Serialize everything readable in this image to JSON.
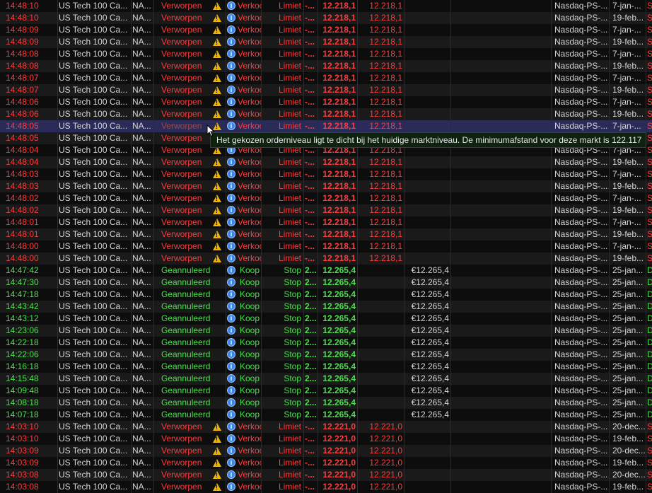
{
  "rows": [
    {
      "time": "14:48:10",
      "instrument": "US Tech 100 Ca...",
      "account": "NA...",
      "status": "Verworpen",
      "warn": true,
      "side": "Verkoop",
      "type": "Limiet",
      "dur": "-...",
      "price": "12.218,1",
      "level": "12.218,1",
      "value": "",
      "market": "Nasdaq-PS-...",
      "date": "7-jan-...",
      "tag": "S",
      "color": "red"
    },
    {
      "time": "14:48:10",
      "instrument": "US Tech 100 Ca...",
      "account": "NA...",
      "status": "Verworpen",
      "warn": true,
      "side": "Verkoop",
      "type": "Limiet",
      "dur": "-...",
      "price": "12.218,1",
      "level": "12.218,1",
      "value": "",
      "market": "Nasdaq-PS-...",
      "date": "19-feb...",
      "tag": "S",
      "color": "red"
    },
    {
      "time": "14:48:09",
      "instrument": "US Tech 100 Ca...",
      "account": "NA...",
      "status": "Verworpen",
      "warn": true,
      "side": "Verkoop",
      "type": "Limiet",
      "dur": "-...",
      "price": "12.218,1",
      "level": "12.218,1",
      "value": "",
      "market": "Nasdaq-PS-...",
      "date": "7-jan-...",
      "tag": "S",
      "color": "red"
    },
    {
      "time": "14:48:09",
      "instrument": "US Tech 100 Ca...",
      "account": "NA...",
      "status": "Verworpen",
      "warn": true,
      "side": "Verkoop",
      "type": "Limiet",
      "dur": "-...",
      "price": "12.218,1",
      "level": "12.218,1",
      "value": "",
      "market": "Nasdaq-PS-...",
      "date": "19-feb...",
      "tag": "S",
      "color": "red"
    },
    {
      "time": "14:48:08",
      "instrument": "US Tech 100 Ca...",
      "account": "NA...",
      "status": "Verworpen",
      "warn": true,
      "side": "Verkoop",
      "type": "Limiet",
      "dur": "-...",
      "price": "12.218,1",
      "level": "12.218,1",
      "value": "",
      "market": "Nasdaq-PS-...",
      "date": "7-jan-...",
      "tag": "S",
      "color": "red"
    },
    {
      "time": "14:48:08",
      "instrument": "US Tech 100 Ca...",
      "account": "NA...",
      "status": "Verworpen",
      "warn": true,
      "side": "Verkoop",
      "type": "Limiet",
      "dur": "-...",
      "price": "12.218,1",
      "level": "12.218,1",
      "value": "",
      "market": "Nasdaq-PS-...",
      "date": "19-feb...",
      "tag": "S",
      "color": "red"
    },
    {
      "time": "14:48:07",
      "instrument": "US Tech 100 Ca...",
      "account": "NA...",
      "status": "Verworpen",
      "warn": true,
      "side": "Verkoop",
      "type": "Limiet",
      "dur": "-...",
      "price": "12.218,1",
      "level": "12.218,1",
      "value": "",
      "market": "Nasdaq-PS-...",
      "date": "7-jan-...",
      "tag": "S",
      "color": "red"
    },
    {
      "time": "14:48:07",
      "instrument": "US Tech 100 Ca...",
      "account": "NA...",
      "status": "Verworpen",
      "warn": true,
      "side": "Verkoop",
      "type": "Limiet",
      "dur": "-...",
      "price": "12.218,1",
      "level": "12.218,1",
      "value": "",
      "market": "Nasdaq-PS-...",
      "date": "19-feb...",
      "tag": "S",
      "color": "red"
    },
    {
      "time": "14:48:06",
      "instrument": "US Tech 100 Ca...",
      "account": "NA...",
      "status": "Verworpen",
      "warn": true,
      "side": "Verkoop",
      "type": "Limiet",
      "dur": "-...",
      "price": "12.218,1",
      "level": "12.218,1",
      "value": "",
      "market": "Nasdaq-PS-...",
      "date": "7-jan-...",
      "tag": "S",
      "color": "red"
    },
    {
      "time": "14:48:06",
      "instrument": "US Tech 100 Ca...",
      "account": "NA...",
      "status": "Verworpen",
      "warn": true,
      "side": "Verkoop",
      "type": "Limiet",
      "dur": "-...",
      "price": "12.218,1",
      "level": "12.218,1",
      "value": "",
      "market": "Nasdaq-PS-...",
      "date": "19-feb...",
      "tag": "S",
      "color": "red"
    },
    {
      "time": "14:48:05",
      "instrument": "US Tech 100 Ca...",
      "account": "NA...",
      "status": "Verworpen",
      "warn": true,
      "side": "Verkoop",
      "type": "Limiet",
      "dur": "-...",
      "price": "12.218,1",
      "level": "12.218,1",
      "value": "",
      "market": "Nasdaq-PS-...",
      "date": "7-jan-...",
      "tag": "S",
      "color": "red",
      "selected": true
    },
    {
      "time": "14:48:05",
      "instrument": "US Tech 100 Ca...",
      "account": "NA...",
      "status": "Verworpen",
      "warn": true,
      "side": "Verkoop",
      "type": "Limiet",
      "dur": "-...",
      "price": "12.218,1",
      "level": "12.218,1",
      "value": "",
      "market": "Nasdaq-PS-...",
      "date": "19-feb...",
      "tag": "S",
      "color": "red"
    },
    {
      "time": "14:48:04",
      "instrument": "US Tech 100 Ca...",
      "account": "NA...",
      "status": "Verworpen",
      "warn": true,
      "side": "Verkoop",
      "type": "Limiet",
      "dur": "-...",
      "price": "12.218,1",
      "level": "12.218,1",
      "value": "",
      "market": "Nasdaq-PS-...",
      "date": "7-jan-...",
      "tag": "S",
      "color": "red"
    },
    {
      "time": "14:48:04",
      "instrument": "US Tech 100 Ca...",
      "account": "NA...",
      "status": "Verworpen",
      "warn": true,
      "side": "Verkoop",
      "type": "Limiet",
      "dur": "-...",
      "price": "12.218,1",
      "level": "12.218,1",
      "value": "",
      "market": "Nasdaq-PS-...",
      "date": "19-feb...",
      "tag": "S",
      "color": "red"
    },
    {
      "time": "14:48:03",
      "instrument": "US Tech 100 Ca...",
      "account": "NA...",
      "status": "Verworpen",
      "warn": true,
      "side": "Verkoop",
      "type": "Limiet",
      "dur": "-...",
      "price": "12.218,1",
      "level": "12.218,1",
      "value": "",
      "market": "Nasdaq-PS-...",
      "date": "7-jan-...",
      "tag": "S",
      "color": "red"
    },
    {
      "time": "14:48:03",
      "instrument": "US Tech 100 Ca...",
      "account": "NA...",
      "status": "Verworpen",
      "warn": true,
      "side": "Verkoop",
      "type": "Limiet",
      "dur": "-...",
      "price": "12.218,1",
      "level": "12.218,1",
      "value": "",
      "market": "Nasdaq-PS-...",
      "date": "19-feb...",
      "tag": "S",
      "color": "red"
    },
    {
      "time": "14:48:02",
      "instrument": "US Tech 100 Ca...",
      "account": "NA...",
      "status": "Verworpen",
      "warn": true,
      "side": "Verkoop",
      "type": "Limiet",
      "dur": "-...",
      "price": "12.218,1",
      "level": "12.218,1",
      "value": "",
      "market": "Nasdaq-PS-...",
      "date": "7-jan-...",
      "tag": "S",
      "color": "red"
    },
    {
      "time": "14:48:02",
      "instrument": "US Tech 100 Ca...",
      "account": "NA...",
      "status": "Verworpen",
      "warn": true,
      "side": "Verkoop",
      "type": "Limiet",
      "dur": "-...",
      "price": "12.218,1",
      "level": "12.218,1",
      "value": "",
      "market": "Nasdaq-PS-...",
      "date": "19-feb...",
      "tag": "S",
      "color": "red"
    },
    {
      "time": "14:48:01",
      "instrument": "US Tech 100 Ca...",
      "account": "NA...",
      "status": "Verworpen",
      "warn": true,
      "side": "Verkoop",
      "type": "Limiet",
      "dur": "-...",
      "price": "12.218,1",
      "level": "12.218,1",
      "value": "",
      "market": "Nasdaq-PS-...",
      "date": "7-jan-...",
      "tag": "S",
      "color": "red"
    },
    {
      "time": "14:48:01",
      "instrument": "US Tech 100 Ca...",
      "account": "NA...",
      "status": "Verworpen",
      "warn": true,
      "side": "Verkoop",
      "type": "Limiet",
      "dur": "-...",
      "price": "12.218,1",
      "level": "12.218,1",
      "value": "",
      "market": "Nasdaq-PS-...",
      "date": "19-feb...",
      "tag": "S",
      "color": "red"
    },
    {
      "time": "14:48:00",
      "instrument": "US Tech 100 Ca...",
      "account": "NA...",
      "status": "Verworpen",
      "warn": true,
      "side": "Verkoop",
      "type": "Limiet",
      "dur": "-...",
      "price": "12.218,1",
      "level": "12.218,1",
      "value": "",
      "market": "Nasdaq-PS-...",
      "date": "7-jan-...",
      "tag": "S",
      "color": "red"
    },
    {
      "time": "14:48:00",
      "instrument": "US Tech 100 Ca...",
      "account": "NA...",
      "status": "Verworpen",
      "warn": true,
      "side": "Verkoop",
      "type": "Limiet",
      "dur": "-...",
      "price": "12.218,1",
      "level": "12.218,1",
      "value": "",
      "market": "Nasdaq-PS-...",
      "date": "19-feb...",
      "tag": "S",
      "color": "red"
    },
    {
      "time": "14:47:42",
      "instrument": "US Tech 100 Ca...",
      "account": "NA...",
      "status": "Geannuleerd",
      "warn": false,
      "side": "Koop",
      "type": "Stop",
      "dur": "2...",
      "price": "12.265,4",
      "level": "",
      "value": "€12.265,4",
      "market": "Nasdaq-PS-...",
      "date": "25-jan...",
      "tag": "D",
      "color": "green"
    },
    {
      "time": "14:47:30",
      "instrument": "US Tech 100 Ca...",
      "account": "NA...",
      "status": "Geannuleerd",
      "warn": false,
      "side": "Koop",
      "type": "Stop",
      "dur": "2...",
      "price": "12.265,4",
      "level": "",
      "value": "€12.265,4",
      "market": "Nasdaq-PS-...",
      "date": "25-jan...",
      "tag": "D",
      "color": "green"
    },
    {
      "time": "14:47:18",
      "instrument": "US Tech 100 Ca...",
      "account": "NA...",
      "status": "Geannuleerd",
      "warn": false,
      "side": "Koop",
      "type": "Stop",
      "dur": "2...",
      "price": "12.265,4",
      "level": "",
      "value": "€12.265,4",
      "market": "Nasdaq-PS-...",
      "date": "25-jan...",
      "tag": "D",
      "color": "green"
    },
    {
      "time": "14:43:42",
      "instrument": "US Tech 100 Ca...",
      "account": "NA...",
      "status": "Geannuleerd",
      "warn": false,
      "side": "Koop",
      "type": "Stop",
      "dur": "2...",
      "price": "12.265,4",
      "level": "",
      "value": "€12.265,4",
      "market": "Nasdaq-PS-...",
      "date": "25-jan...",
      "tag": "D",
      "color": "green"
    },
    {
      "time": "14:43:12",
      "instrument": "US Tech 100 Ca...",
      "account": "NA...",
      "status": "Geannuleerd",
      "warn": false,
      "side": "Koop",
      "type": "Stop",
      "dur": "2...",
      "price": "12.265,4",
      "level": "",
      "value": "€12.265,4",
      "market": "Nasdaq-PS-...",
      "date": "25-jan...",
      "tag": "D",
      "color": "green"
    },
    {
      "time": "14:23:06",
      "instrument": "US Tech 100 Ca...",
      "account": "NA...",
      "status": "Geannuleerd",
      "warn": false,
      "side": "Koop",
      "type": "Stop",
      "dur": "2...",
      "price": "12.265,4",
      "level": "",
      "value": "€12.265,4",
      "market": "Nasdaq-PS-...",
      "date": "25-jan...",
      "tag": "D",
      "color": "green"
    },
    {
      "time": "14:22:18",
      "instrument": "US Tech 100 Ca...",
      "account": "NA...",
      "status": "Geannuleerd",
      "warn": false,
      "side": "Koop",
      "type": "Stop",
      "dur": "2...",
      "price": "12.265,4",
      "level": "",
      "value": "€12.265,4",
      "market": "Nasdaq-PS-...",
      "date": "25-jan...",
      "tag": "D",
      "color": "green"
    },
    {
      "time": "14:22:06",
      "instrument": "US Tech 100 Ca...",
      "account": "NA...",
      "status": "Geannuleerd",
      "warn": false,
      "side": "Koop",
      "type": "Stop",
      "dur": "2...",
      "price": "12.265,4",
      "level": "",
      "value": "€12.265,4",
      "market": "Nasdaq-PS-...",
      "date": "25-jan...",
      "tag": "D",
      "color": "green"
    },
    {
      "time": "14:16:18",
      "instrument": "US Tech 100 Ca...",
      "account": "NA...",
      "status": "Geannuleerd",
      "warn": false,
      "side": "Koop",
      "type": "Stop",
      "dur": "2...",
      "price": "12.265,4",
      "level": "",
      "value": "€12.265,4",
      "market": "Nasdaq-PS-...",
      "date": "25-jan...",
      "tag": "D",
      "color": "green"
    },
    {
      "time": "14:15:48",
      "instrument": "US Tech 100 Ca...",
      "account": "NA...",
      "status": "Geannuleerd",
      "warn": false,
      "side": "Koop",
      "type": "Stop",
      "dur": "2...",
      "price": "12.265,4",
      "level": "",
      "value": "€12.265,4",
      "market": "Nasdaq-PS-...",
      "date": "25-jan...",
      "tag": "D",
      "color": "green"
    },
    {
      "time": "14:09:48",
      "instrument": "US Tech 100 Ca...",
      "account": "NA...",
      "status": "Geannuleerd",
      "warn": false,
      "side": "Koop",
      "type": "Stop",
      "dur": "2...",
      "price": "12.265,4",
      "level": "",
      "value": "€12.265,4",
      "market": "Nasdaq-PS-...",
      "date": "25-jan...",
      "tag": "D",
      "color": "green"
    },
    {
      "time": "14:08:18",
      "instrument": "US Tech 100 Ca...",
      "account": "NA...",
      "status": "Geannuleerd",
      "warn": false,
      "side": "Koop",
      "type": "Stop",
      "dur": "2...",
      "price": "12.265,4",
      "level": "",
      "value": "€12.265,4",
      "market": "Nasdaq-PS-...",
      "date": "25-jan...",
      "tag": "D",
      "color": "green"
    },
    {
      "time": "14:07:18",
      "instrument": "US Tech 100 Ca...",
      "account": "NA...",
      "status": "Geannuleerd",
      "warn": false,
      "side": "Koop",
      "type": "Stop",
      "dur": "2...",
      "price": "12.265,4",
      "level": "",
      "value": "€12.265,4",
      "market": "Nasdaq-PS-...",
      "date": "25-jan...",
      "tag": "D",
      "color": "green"
    },
    {
      "time": "14:03:10",
      "instrument": "US Tech 100 Ca...",
      "account": "NA...",
      "status": "Verworpen",
      "warn": true,
      "side": "Verkoop",
      "type": "Limiet",
      "dur": "-...",
      "price": "12.221,0",
      "level": "12.221,0",
      "value": "",
      "market": "Nasdaq-PS-...",
      "date": "20-dec...",
      "tag": "S",
      "color": "red"
    },
    {
      "time": "14:03:10",
      "instrument": "US Tech 100 Ca...",
      "account": "NA...",
      "status": "Verworpen",
      "warn": true,
      "side": "Verkoop",
      "type": "Limiet",
      "dur": "-...",
      "price": "12.221,0",
      "level": "12.221,0",
      "value": "",
      "market": "Nasdaq-PS-...",
      "date": "19-feb...",
      "tag": "S",
      "color": "red"
    },
    {
      "time": "14:03:09",
      "instrument": "US Tech 100 Ca...",
      "account": "NA...",
      "status": "Verworpen",
      "warn": true,
      "side": "Verkoop",
      "type": "Limiet",
      "dur": "-...",
      "price": "12.221,0",
      "level": "12.221,0",
      "value": "",
      "market": "Nasdaq-PS-...",
      "date": "20-dec...",
      "tag": "S",
      "color": "red"
    },
    {
      "time": "14:03:09",
      "instrument": "US Tech 100 Ca...",
      "account": "NA...",
      "status": "Verworpen",
      "warn": true,
      "side": "Verkoop",
      "type": "Limiet",
      "dur": "-...",
      "price": "12.221,0",
      "level": "12.221,0",
      "value": "",
      "market": "Nasdaq-PS-...",
      "date": "19-feb...",
      "tag": "S",
      "color": "red"
    },
    {
      "time": "14:03:08",
      "instrument": "US Tech 100 Ca...",
      "account": "NA...",
      "status": "Verworpen",
      "warn": true,
      "side": "Verkoop",
      "type": "Limiet",
      "dur": "-...",
      "price": "12.221,0",
      "level": "12.221,0",
      "value": "",
      "market": "Nasdaq-PS-...",
      "date": "20-dec...",
      "tag": "S",
      "color": "red"
    },
    {
      "time": "14:03:08",
      "instrument": "US Tech 100 Ca...",
      "account": "NA...",
      "status": "Verworpen",
      "warn": true,
      "side": "Verkoop",
      "type": "Limiet",
      "dur": "-...",
      "price": "12.221,0",
      "level": "12.221,0",
      "value": "",
      "market": "Nasdaq-PS-...",
      "date": "19-feb...",
      "tag": "S",
      "color": "red"
    }
  ],
  "tooltip": {
    "text": "Het gekozen orderniveau ligt te dicht bij het huidige marktniveau. De minimumafstand voor deze markt is 122.117"
  },
  "icons": {
    "info": "i",
    "warning": "warning-icon"
  },
  "colors": {
    "rejected": "#ff3b3b",
    "cancelled": "#4be04b",
    "selected_row": "#2b2b5a",
    "tooltip_bg": "#0f220f"
  }
}
